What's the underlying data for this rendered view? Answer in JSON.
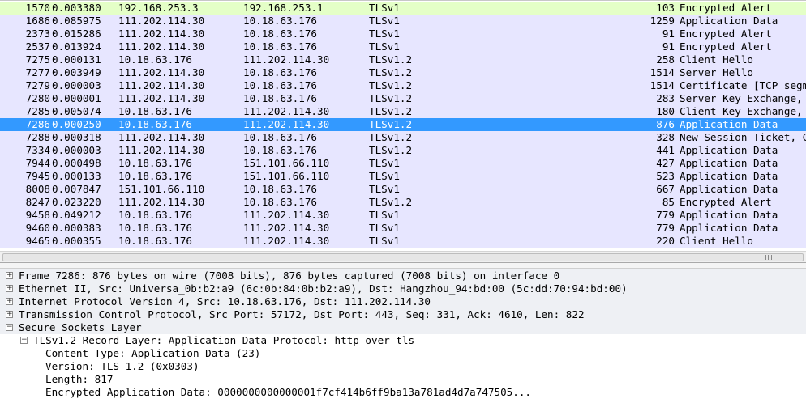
{
  "packets": [
    {
      "no": "1570",
      "time": "0.003380",
      "src": "192.168.253.3",
      "dst": "192.168.253.1",
      "proto": "TLSv1",
      "len": "103",
      "info": "Encrypted Alert",
      "bg": "#e4ffc7",
      "fg": "#000000"
    },
    {
      "no": "1686",
      "time": "0.085975",
      "src": "111.202.114.30",
      "dst": "10.18.63.176",
      "proto": "TLSv1",
      "len": "1259",
      "info": "Application Data",
      "bg": "#e7e6ff",
      "fg": "#000000"
    },
    {
      "no": "2373",
      "time": "0.015286",
      "src": "111.202.114.30",
      "dst": "10.18.63.176",
      "proto": "TLSv1",
      "len": "91",
      "info": "Encrypted Alert",
      "bg": "#e7e6ff",
      "fg": "#000000"
    },
    {
      "no": "2537",
      "time": "0.013924",
      "src": "111.202.114.30",
      "dst": "10.18.63.176",
      "proto": "TLSv1",
      "len": "91",
      "info": "Encrypted Alert",
      "bg": "#e7e6ff",
      "fg": "#000000"
    },
    {
      "no": "7275",
      "time": "0.000131",
      "src": "10.18.63.176",
      "dst": "111.202.114.30",
      "proto": "TLSv1.2",
      "len": "258",
      "info": "Client Hello",
      "bg": "#e7e6ff",
      "fg": "#000000"
    },
    {
      "no": "7277",
      "time": "0.003949",
      "src": "111.202.114.30",
      "dst": "10.18.63.176",
      "proto": "TLSv1.2",
      "len": "1514",
      "info": "Server Hello",
      "bg": "#e7e6ff",
      "fg": "#000000"
    },
    {
      "no": "7279",
      "time": "0.000003",
      "src": "111.202.114.30",
      "dst": "10.18.63.176",
      "proto": "TLSv1.2",
      "len": "1514",
      "info": "Certificate [TCP segment of a reassembled PDU]",
      "bg": "#e7e6ff",
      "fg": "#000000"
    },
    {
      "no": "7280",
      "time": "0.000001",
      "src": "111.202.114.30",
      "dst": "10.18.63.176",
      "proto": "TLSv1.2",
      "len": "283",
      "info": "Server Key Exchange, Server Hello Done",
      "bg": "#e7e6ff",
      "fg": "#000000"
    },
    {
      "no": "7285",
      "time": "0.005074",
      "src": "10.18.63.176",
      "dst": "111.202.114.30",
      "proto": "TLSv1.2",
      "len": "180",
      "info": "Client Key Exchange, Change Cipher Spec",
      "bg": "#e7e6ff",
      "fg": "#000000"
    },
    {
      "no": "7286",
      "time": "0.000250",
      "src": "10.18.63.176",
      "dst": "111.202.114.30",
      "proto": "TLSv1.2",
      "len": "876",
      "info": "Application Data",
      "bg": "#3399ff",
      "fg": "#ffffff",
      "selected": true
    },
    {
      "no": "7288",
      "time": "0.000318",
      "src": "111.202.114.30",
      "dst": "10.18.63.176",
      "proto": "TLSv1.2",
      "len": "328",
      "info": "New Session Ticket, Change Cipher Spec",
      "bg": "#e7e6ff",
      "fg": "#000000"
    },
    {
      "no": "7334",
      "time": "0.000003",
      "src": "111.202.114.30",
      "dst": "10.18.63.176",
      "proto": "TLSv1.2",
      "len": "441",
      "info": "Application Data",
      "bg": "#e7e6ff",
      "fg": "#000000"
    },
    {
      "no": "7944",
      "time": "0.000498",
      "src": "10.18.63.176",
      "dst": "151.101.66.110",
      "proto": "TLSv1",
      "len": "427",
      "info": "Application Data",
      "bg": "#e7e6ff",
      "fg": "#000000"
    },
    {
      "no": "7945",
      "time": "0.000133",
      "src": "10.18.63.176",
      "dst": "151.101.66.110",
      "proto": "TLSv1",
      "len": "523",
      "info": "Application Data",
      "bg": "#e7e6ff",
      "fg": "#000000"
    },
    {
      "no": "8008",
      "time": "0.007847",
      "src": "151.101.66.110",
      "dst": "10.18.63.176",
      "proto": "TLSv1",
      "len": "667",
      "info": "Application Data",
      "bg": "#e7e6ff",
      "fg": "#000000"
    },
    {
      "no": "8247",
      "time": "0.023220",
      "src": "111.202.114.30",
      "dst": "10.18.63.176",
      "proto": "TLSv1.2",
      "len": "85",
      "info": "Encrypted Alert",
      "bg": "#e7e6ff",
      "fg": "#000000"
    },
    {
      "no": "9458",
      "time": "0.049212",
      "src": "10.18.63.176",
      "dst": "111.202.114.30",
      "proto": "TLSv1",
      "len": "779",
      "info": "Application Data",
      "bg": "#e7e6ff",
      "fg": "#000000"
    },
    {
      "no": "9460",
      "time": "0.000383",
      "src": "10.18.63.176",
      "dst": "111.202.114.30",
      "proto": "TLSv1",
      "len": "779",
      "info": "Application Data",
      "bg": "#e7e6ff",
      "fg": "#000000"
    },
    {
      "no": "9465",
      "time": "0.000355",
      "src": "10.18.63.176",
      "dst": "111.202.114.30",
      "proto": "TLSv1",
      "len": "220",
      "info": "Client Hello",
      "bg": "#e7e6ff",
      "fg": "#000000"
    }
  ],
  "scrollbar": {
    "grip_icon": "grip-lines-icon"
  },
  "details": [
    {
      "expander": "+",
      "text": "Frame 7286: 876 bytes on wire (7008 bits), 876 bytes captured (7008 bits) on interface 0",
      "shaded": true
    },
    {
      "expander": "+",
      "text": "Ethernet II, Src: Universa_0b:b2:a9 (6c:0b:84:0b:b2:a9), Dst: Hangzhou_94:bd:00 (5c:dd:70:94:bd:00)",
      "shaded": true
    },
    {
      "expander": "+",
      "text": "Internet Protocol Version 4, Src: 10.18.63.176, Dst: 111.202.114.30",
      "shaded": true
    },
    {
      "expander": "+",
      "text": "Transmission Control Protocol, Src Port: 57172, Dst Port: 443, Seq: 331, Ack: 4610, Len: 822",
      "shaded": true
    },
    {
      "expander": "−",
      "text": "Secure Sockets Layer",
      "shaded": true
    },
    {
      "expander": "−",
      "text": "TLSv1.2 Record Layer: Application Data Protocol: http-over-tls",
      "shaded": false,
      "level": 1
    },
    {
      "expander": "",
      "text": "Content Type: Application Data (23)",
      "shaded": false,
      "level": 2
    },
    {
      "expander": "",
      "text": "Version: TLS 1.2 (0x0303)",
      "shaded": false,
      "level": 2
    },
    {
      "expander": "",
      "text": "Length: 817",
      "shaded": false,
      "level": 2
    },
    {
      "expander": "",
      "text": "Encrypted Application Data: 0000000000000001f7cf414b6ff9ba13a781ad4d7a747505...",
      "shaded": false,
      "level": 2
    }
  ]
}
